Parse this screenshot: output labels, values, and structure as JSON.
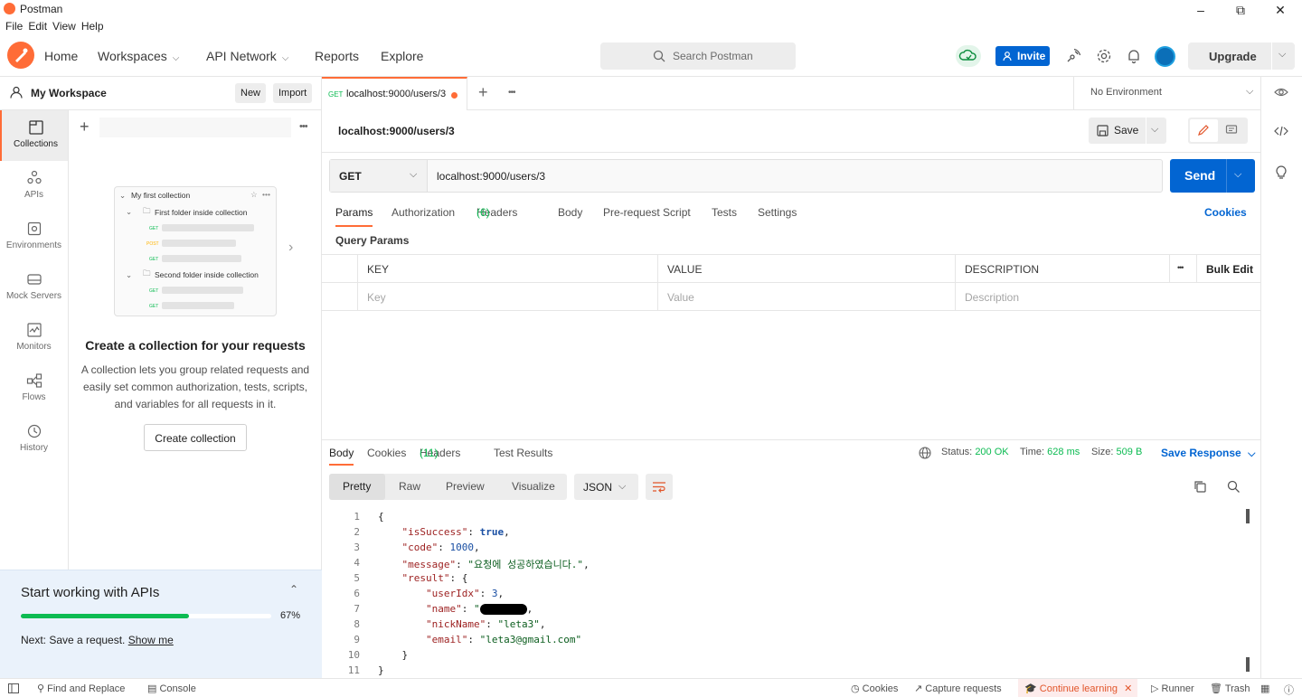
{
  "window": {
    "title": "Postman",
    "menu": [
      "File",
      "Edit",
      "View",
      "Help"
    ]
  },
  "header": {
    "nav": [
      "Home",
      "Workspaces",
      "API Network",
      "Reports",
      "Explore"
    ],
    "search_placeholder": "Search Postman",
    "invite_label": "Invite",
    "upgrade_label": "Upgrade"
  },
  "workspace": {
    "name": "My Workspace",
    "new_label": "New",
    "import_label": "Import"
  },
  "sidebar": {
    "items": [
      {
        "label": "Collections",
        "icon": "collections-icon"
      },
      {
        "label": "APIs",
        "icon": "apis-icon"
      },
      {
        "label": "Environments",
        "icon": "environments-icon"
      },
      {
        "label": "Mock Servers",
        "icon": "mock-servers-icon"
      },
      {
        "label": "Monitors",
        "icon": "monitors-icon"
      },
      {
        "label": "Flows",
        "icon": "flows-icon"
      },
      {
        "label": "History",
        "icon": "history-icon"
      }
    ]
  },
  "collections_panel": {
    "preview": {
      "collection": "My first collection",
      "folder1": "First folder inside collection",
      "folder2": "Second folder inside collection",
      "methods": [
        "GET",
        "POST",
        "GET",
        "GET",
        "GET"
      ]
    },
    "title": "Create a collection for your requests",
    "desc1": "A collection lets you group related requests and",
    "desc2": "easily set common authorization, tests, scripts,",
    "desc3": "and variables for all requests in it.",
    "button": "Create collection"
  },
  "start_panel": {
    "title": "Start working with APIs",
    "progress": 67,
    "progress_label": "67%",
    "next_prefix": "Next: Save a request.",
    "next_link": "Show me"
  },
  "tab": {
    "method": "GET",
    "url": "localhost:9000/users/3"
  },
  "environment": "No Environment",
  "request": {
    "name": "localhost:9000/users/3",
    "save_label": "Save",
    "method": "GET",
    "url": "localhost:9000/users/3",
    "send_label": "Send",
    "tabs": [
      {
        "label": "Params"
      },
      {
        "label": "Authorization"
      },
      {
        "label": "Headers",
        "count": "(6)"
      },
      {
        "label": "Body"
      },
      {
        "label": "Pre-request Script"
      },
      {
        "label": "Tests"
      },
      {
        "label": "Settings"
      }
    ],
    "cookies_label": "Cookies",
    "query_params_title": "Query Params",
    "table": {
      "headers": [
        "KEY",
        "VALUE",
        "DESCRIPTION"
      ],
      "bulk_edit": "Bulk Edit",
      "placeholders": [
        "Key",
        "Value",
        "Description"
      ]
    }
  },
  "response": {
    "tabs": [
      {
        "label": "Body"
      },
      {
        "label": "Cookies"
      },
      {
        "label": "Headers",
        "count": "(11)"
      },
      {
        "label": "Test Results"
      }
    ],
    "status_label": "Status:",
    "status_value": "200 OK",
    "time_label": "Time:",
    "time_value": "628 ms",
    "size_label": "Size:",
    "size_value": "509 B",
    "save_response": "Save Response",
    "formats": [
      "Pretty",
      "Raw",
      "Preview",
      "Visualize"
    ],
    "language": "JSON",
    "body_lines": [
      {
        "n": "1",
        "text": "{"
      },
      {
        "n": "2",
        "key": "\"isSuccess\"",
        "value": "true",
        "type": "b",
        "indent": 1,
        "comma": ","
      },
      {
        "n": "3",
        "key": "\"code\"",
        "value": "1000",
        "type": "n",
        "indent": 1,
        "comma": ","
      },
      {
        "n": "4",
        "key": "\"message\"",
        "value": "\"요청에 성공하였습니다.\"",
        "type": "s",
        "indent": 1,
        "comma": ","
      },
      {
        "n": "5",
        "key": "\"result\"",
        "value": "{",
        "type": "p",
        "indent": 1,
        "comma": ""
      },
      {
        "n": "6",
        "key": "\"userIdx\"",
        "value": "3",
        "type": "n",
        "indent": 2,
        "comma": ","
      },
      {
        "n": "7",
        "key": "\"name\"",
        "value": "\"",
        "type": "redact",
        "indent": 2,
        "comma": ","
      },
      {
        "n": "8",
        "key": "\"nickName\"",
        "value": "\"leta3\"",
        "type": "s",
        "indent": 2,
        "comma": ","
      },
      {
        "n": "9",
        "key": "\"email\"",
        "value": "\"leta3@gmail.com\"",
        "type": "s",
        "indent": 2,
        "comma": ""
      },
      {
        "n": "10",
        "text": "    }"
      },
      {
        "n": "11",
        "text": "}"
      }
    ]
  },
  "statusbar": {
    "find_replace": "Find and Replace",
    "console": "Console",
    "cookies": "Cookies",
    "capture": "Capture requests",
    "continue_learning": "Continue learning",
    "runner": "Runner",
    "trash": "Trash"
  },
  "colors": {
    "accent": "#ff6c37",
    "primary": "#0265d2",
    "success": "#0cbb52"
  }
}
